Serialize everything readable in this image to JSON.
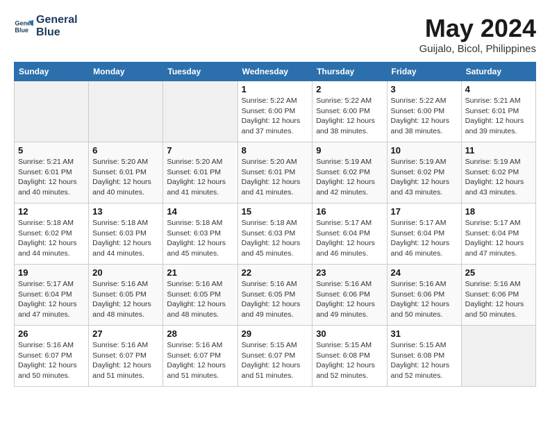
{
  "header": {
    "logo_line1": "General",
    "logo_line2": "Blue",
    "month": "May 2024",
    "location": "Guijalo, Bicol, Philippines"
  },
  "weekdays": [
    "Sunday",
    "Monday",
    "Tuesday",
    "Wednesday",
    "Thursday",
    "Friday",
    "Saturday"
  ],
  "weeks": [
    [
      {
        "day": "",
        "detail": ""
      },
      {
        "day": "",
        "detail": ""
      },
      {
        "day": "",
        "detail": ""
      },
      {
        "day": "1",
        "detail": "Sunrise: 5:22 AM\nSunset: 6:00 PM\nDaylight: 12 hours\nand 37 minutes."
      },
      {
        "day": "2",
        "detail": "Sunrise: 5:22 AM\nSunset: 6:00 PM\nDaylight: 12 hours\nand 38 minutes."
      },
      {
        "day": "3",
        "detail": "Sunrise: 5:22 AM\nSunset: 6:00 PM\nDaylight: 12 hours\nand 38 minutes."
      },
      {
        "day": "4",
        "detail": "Sunrise: 5:21 AM\nSunset: 6:01 PM\nDaylight: 12 hours\nand 39 minutes."
      }
    ],
    [
      {
        "day": "5",
        "detail": "Sunrise: 5:21 AM\nSunset: 6:01 PM\nDaylight: 12 hours\nand 40 minutes."
      },
      {
        "day": "6",
        "detail": "Sunrise: 5:20 AM\nSunset: 6:01 PM\nDaylight: 12 hours\nand 40 minutes."
      },
      {
        "day": "7",
        "detail": "Sunrise: 5:20 AM\nSunset: 6:01 PM\nDaylight: 12 hours\nand 41 minutes."
      },
      {
        "day": "8",
        "detail": "Sunrise: 5:20 AM\nSunset: 6:01 PM\nDaylight: 12 hours\nand 41 minutes."
      },
      {
        "day": "9",
        "detail": "Sunrise: 5:19 AM\nSunset: 6:02 PM\nDaylight: 12 hours\nand 42 minutes."
      },
      {
        "day": "10",
        "detail": "Sunrise: 5:19 AM\nSunset: 6:02 PM\nDaylight: 12 hours\nand 43 minutes."
      },
      {
        "day": "11",
        "detail": "Sunrise: 5:19 AM\nSunset: 6:02 PM\nDaylight: 12 hours\nand 43 minutes."
      }
    ],
    [
      {
        "day": "12",
        "detail": "Sunrise: 5:18 AM\nSunset: 6:02 PM\nDaylight: 12 hours\nand 44 minutes."
      },
      {
        "day": "13",
        "detail": "Sunrise: 5:18 AM\nSunset: 6:03 PM\nDaylight: 12 hours\nand 44 minutes."
      },
      {
        "day": "14",
        "detail": "Sunrise: 5:18 AM\nSunset: 6:03 PM\nDaylight: 12 hours\nand 45 minutes."
      },
      {
        "day": "15",
        "detail": "Sunrise: 5:18 AM\nSunset: 6:03 PM\nDaylight: 12 hours\nand 45 minutes."
      },
      {
        "day": "16",
        "detail": "Sunrise: 5:17 AM\nSunset: 6:04 PM\nDaylight: 12 hours\nand 46 minutes."
      },
      {
        "day": "17",
        "detail": "Sunrise: 5:17 AM\nSunset: 6:04 PM\nDaylight: 12 hours\nand 46 minutes."
      },
      {
        "day": "18",
        "detail": "Sunrise: 5:17 AM\nSunset: 6:04 PM\nDaylight: 12 hours\nand 47 minutes."
      }
    ],
    [
      {
        "day": "19",
        "detail": "Sunrise: 5:17 AM\nSunset: 6:04 PM\nDaylight: 12 hours\nand 47 minutes."
      },
      {
        "day": "20",
        "detail": "Sunrise: 5:16 AM\nSunset: 6:05 PM\nDaylight: 12 hours\nand 48 minutes."
      },
      {
        "day": "21",
        "detail": "Sunrise: 5:16 AM\nSunset: 6:05 PM\nDaylight: 12 hours\nand 48 minutes."
      },
      {
        "day": "22",
        "detail": "Sunrise: 5:16 AM\nSunset: 6:05 PM\nDaylight: 12 hours\nand 49 minutes."
      },
      {
        "day": "23",
        "detail": "Sunrise: 5:16 AM\nSunset: 6:06 PM\nDaylight: 12 hours\nand 49 minutes."
      },
      {
        "day": "24",
        "detail": "Sunrise: 5:16 AM\nSunset: 6:06 PM\nDaylight: 12 hours\nand 50 minutes."
      },
      {
        "day": "25",
        "detail": "Sunrise: 5:16 AM\nSunset: 6:06 PM\nDaylight: 12 hours\nand 50 minutes."
      }
    ],
    [
      {
        "day": "26",
        "detail": "Sunrise: 5:16 AM\nSunset: 6:07 PM\nDaylight: 12 hours\nand 50 minutes."
      },
      {
        "day": "27",
        "detail": "Sunrise: 5:16 AM\nSunset: 6:07 PM\nDaylight: 12 hours\nand 51 minutes."
      },
      {
        "day": "28",
        "detail": "Sunrise: 5:16 AM\nSunset: 6:07 PM\nDaylight: 12 hours\nand 51 minutes."
      },
      {
        "day": "29",
        "detail": "Sunrise: 5:15 AM\nSunset: 6:07 PM\nDaylight: 12 hours\nand 51 minutes."
      },
      {
        "day": "30",
        "detail": "Sunrise: 5:15 AM\nSunset: 6:08 PM\nDaylight: 12 hours\nand 52 minutes."
      },
      {
        "day": "31",
        "detail": "Sunrise: 5:15 AM\nSunset: 6:08 PM\nDaylight: 12 hours\nand 52 minutes."
      },
      {
        "day": "",
        "detail": ""
      }
    ]
  ]
}
